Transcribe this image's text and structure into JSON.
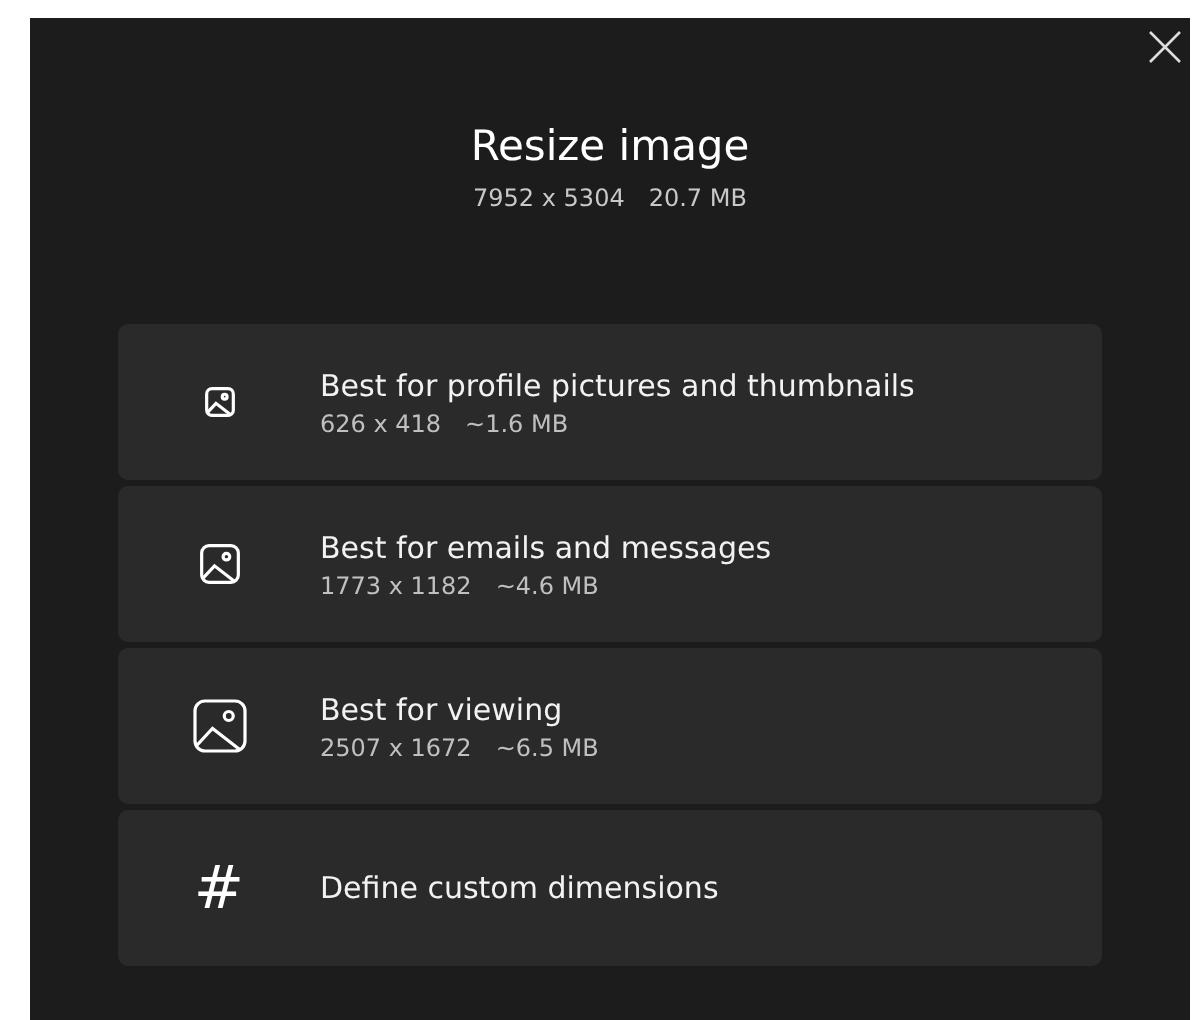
{
  "dialog": {
    "title": "Resize image",
    "dimensions": "7952 x 5304",
    "size": "20.7 MB"
  },
  "options": [
    {
      "kind": "preset",
      "title": "Best for profile pictures and thumbnails",
      "dimensions": "626 x 418",
      "size": "~1.6 MB"
    },
    {
      "kind": "preset",
      "title": "Best for emails and messages",
      "dimensions": "1773 x 1182",
      "size": "~4.6 MB"
    },
    {
      "kind": "preset",
      "title": "Best for viewing",
      "dimensions": "2507 x 1672",
      "size": "~6.5 MB"
    },
    {
      "kind": "custom",
      "glyph": "#",
      "title": "Define custom dimensions"
    }
  ]
}
